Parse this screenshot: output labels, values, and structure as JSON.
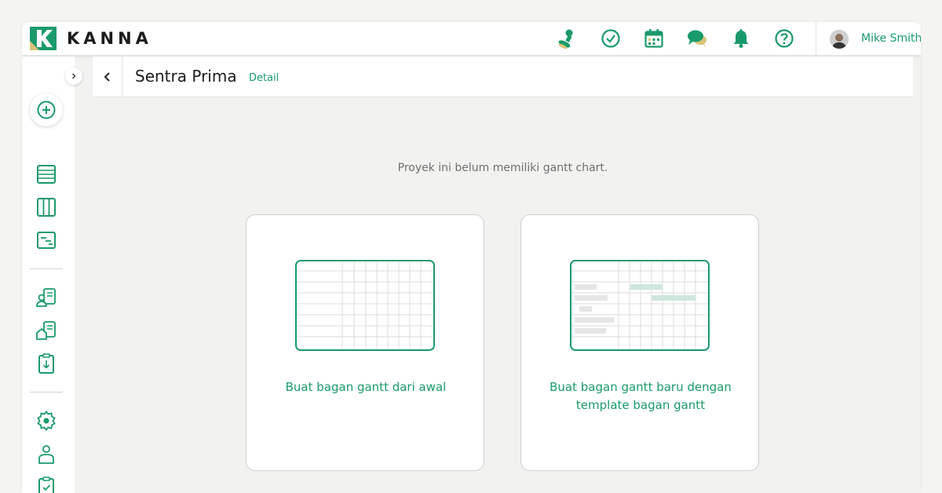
{
  "header": {
    "brand": "KANNA",
    "icons": [
      "stamp-icon",
      "check-circle-icon",
      "calendar-icon",
      "chat-icon",
      "bell-icon",
      "help-icon"
    ],
    "user_name": "Mike Smith"
  },
  "sidebar": {
    "items": [
      "add-icon",
      "list-view-icon",
      "board-view-icon",
      "gantt-view-icon",
      "client-icon",
      "property-icon",
      "clipboard-download-icon",
      "settings-icon",
      "user-icon",
      "clipboard-check-icon"
    ]
  },
  "project": {
    "title": "Sentra Prima",
    "detail_link": "Detail"
  },
  "main": {
    "empty_message": "Proyek ini belum memiliki gantt chart.",
    "cards": [
      {
        "label": "Buat bagan gantt dari awal"
      },
      {
        "label": "Buat bagan gantt baru dengan template bagan gantt"
      }
    ]
  },
  "colors": {
    "brand_green": "#1a9a6a",
    "logo_gold": "#d9c27a"
  }
}
